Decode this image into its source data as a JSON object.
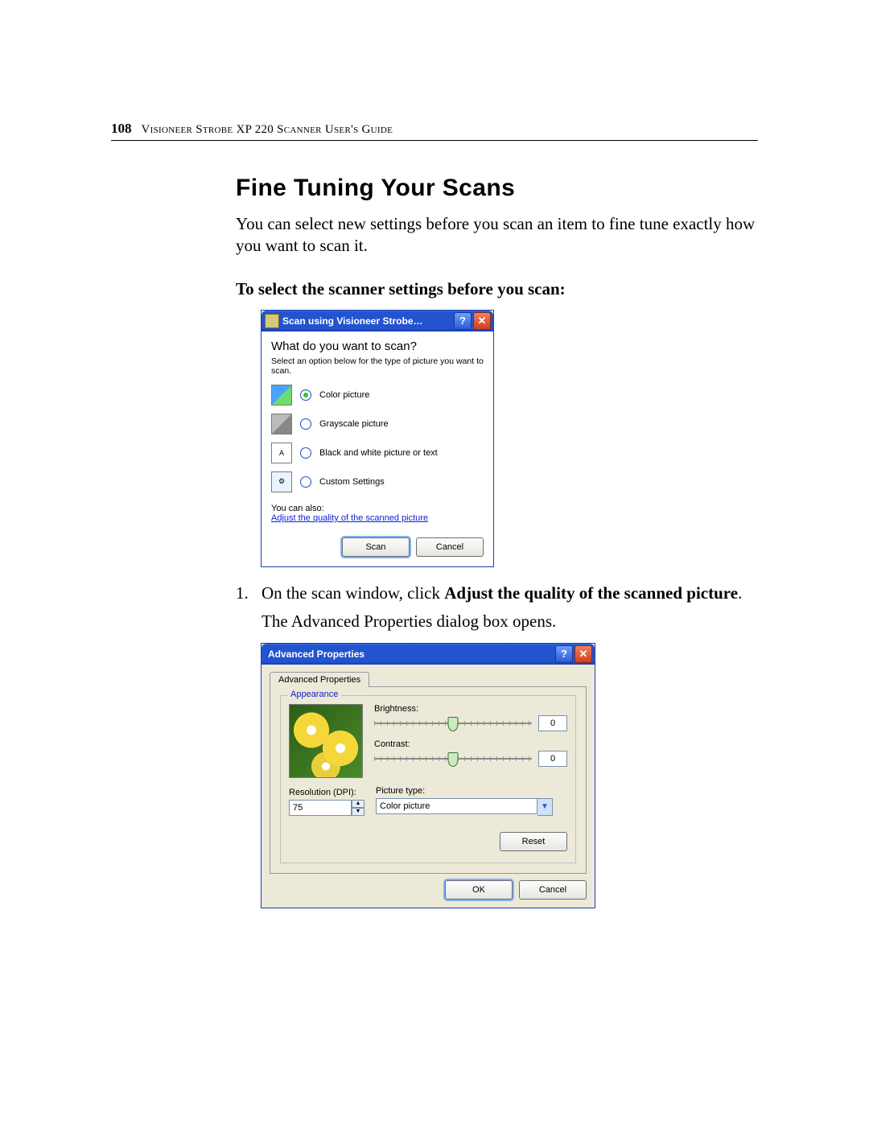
{
  "page": {
    "number": "108",
    "running_title": "Visioneer Strobe XP 220 Scanner User's Guide"
  },
  "section": {
    "title": "Fine Tuning Your Scans",
    "intro": "You can select new settings before you scan an item to fine tune exactly how you want to scan it.",
    "subhead": "To select the scanner settings before you scan:",
    "step1_pre": "On the scan window, click ",
    "step1_bold": "Adjust the quality of the scanned picture",
    "step1_post": ".",
    "step1_number": "1.",
    "follow": "The Advanced Properties dialog box opens."
  },
  "dialog1": {
    "title": "Scan using Visioneer Strobe…",
    "question": "What do you want to scan?",
    "subtext": "Select an option below for the type of picture you want to scan.",
    "options": [
      {
        "label": "Color picture",
        "checked": true
      },
      {
        "label": "Grayscale picture",
        "checked": false
      },
      {
        "label": "Black and white picture or text",
        "checked": false
      },
      {
        "label": "Custom Settings",
        "checked": false
      }
    ],
    "you_can_also": "You can also:",
    "adjust_link": "Adjust the quality of the scanned picture",
    "scan_btn": "Scan",
    "cancel_btn": "Cancel"
  },
  "dialog2": {
    "title": "Advanced Properties",
    "tab": "Advanced Properties",
    "group": "Appearance",
    "brightness_label": "Brightness:",
    "brightness_value": "0",
    "contrast_label": "Contrast:",
    "contrast_value": "0",
    "resolution_label": "Resolution (DPI):",
    "resolution_value": "75",
    "picture_type_label": "Picture type:",
    "picture_type_value": "Color picture",
    "reset_btn": "Reset",
    "ok_btn": "OK",
    "cancel_btn": "Cancel"
  }
}
